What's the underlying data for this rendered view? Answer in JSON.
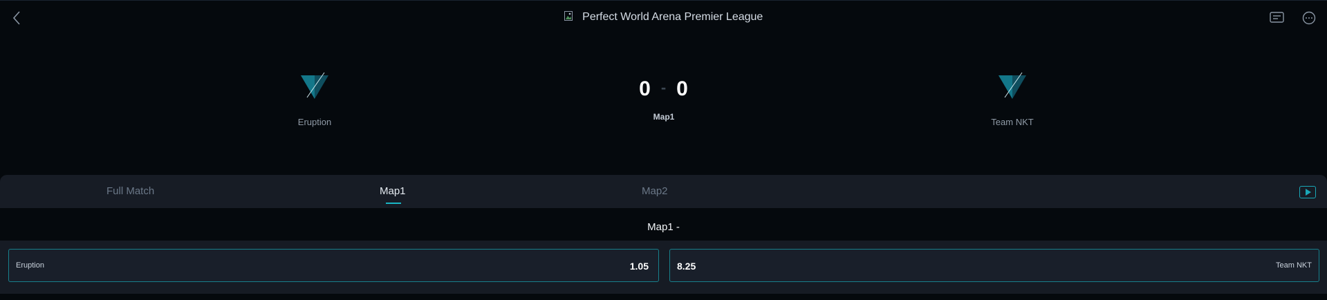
{
  "header": {
    "title": "Perfect World Arena Premier League",
    "back_icon": "chevron-left-icon",
    "actions": [
      "chat-list-icon",
      "message-bubble-icon"
    ]
  },
  "match": {
    "home": {
      "name": "Eruption",
      "logo": "team-logo-triangle"
    },
    "away": {
      "name": "Team NKT",
      "logo": "team-logo-triangle"
    },
    "score_home": "0",
    "score_separator": "-",
    "score_away": "0",
    "current_map": "Map1"
  },
  "tabs": [
    {
      "label": "Full Match",
      "active": false
    },
    {
      "label": "Map1",
      "active": true
    },
    {
      "label": "Map2",
      "active": false
    }
  ],
  "market": {
    "title": "Map1 -",
    "home": {
      "team": "Eruption",
      "odd": "1.05"
    },
    "away": {
      "team": "Team NKT",
      "odd": "8.25"
    }
  },
  "colors": {
    "background": "#05090d",
    "accent": "#19b6c5",
    "panel": "#171c25"
  }
}
